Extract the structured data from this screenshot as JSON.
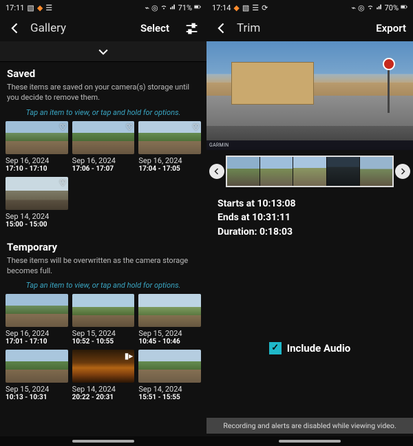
{
  "left": {
    "statusbar": {
      "time": "17:11",
      "battery": "71%"
    },
    "appbar": {
      "title": "Gallery",
      "select": "Select"
    },
    "saved": {
      "title": "Saved",
      "desc": "These items are saved on your camera(s) storage until you decide to remove them.",
      "hint": "Tap an item to view, or tap and hold for options.",
      "items": [
        {
          "date": "Sep 16, 2024",
          "time": "17:10 - 17:10"
        },
        {
          "date": "Sep 16, 2024",
          "time": "17:06 - 17:07"
        },
        {
          "date": "Sep 16, 2024",
          "time": "17:04 - 17:05"
        },
        {
          "date": "Sep 14, 2024",
          "time": "15:00 - 15:00"
        }
      ]
    },
    "temporary": {
      "title": "Temporary",
      "desc": "These items will be overwritten as the camera storage becomes full.",
      "hint": "Tap an item to view, or tap and hold for options.",
      "items": [
        {
          "date": "Sep 16, 2024",
          "time": "17:01 - 17:10"
        },
        {
          "date": "Sep 15, 2024",
          "time": "10:52 - 10:55"
        },
        {
          "date": "Sep 15, 2024",
          "time": "10:45 - 10:46"
        },
        {
          "date": "Sep 15, 2024",
          "time": "10:13 - 10:31"
        },
        {
          "date": "Sep 14, 2024",
          "time": "20:22 - 20:31"
        },
        {
          "date": "Sep 14, 2024",
          "time": "15:51 - 15:55"
        }
      ]
    }
  },
  "right": {
    "statusbar": {
      "time": "17:14",
      "battery": "70%"
    },
    "appbar": {
      "title": "Trim",
      "export": "Export"
    },
    "overlay_brand": "GARMIN",
    "trim": {
      "starts_label": "Starts at ",
      "starts": "10:13:08",
      "ends_label": "Ends at ",
      "ends": "10:31:11",
      "duration_label": "Duration: ",
      "duration": "0:18:03"
    },
    "include_audio": "Include Audio",
    "banner": "Recording and alerts are disabled while viewing video."
  }
}
